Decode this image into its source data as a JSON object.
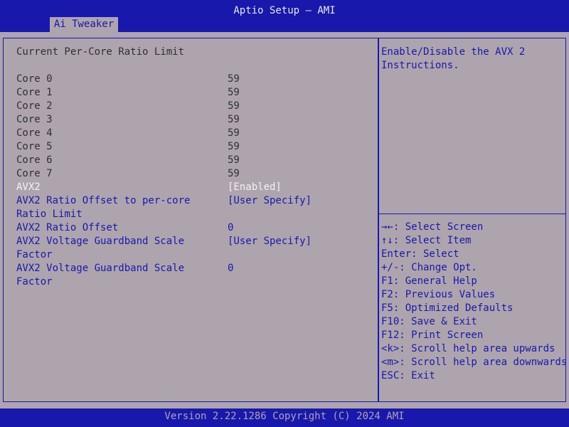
{
  "app_title": "Aptio Setup – AMI",
  "tab": "Ai Tweaker",
  "section_title": "Current Per-Core Ratio Limit",
  "cores": [
    {
      "label": "Core 0",
      "value": "59"
    },
    {
      "label": "Core 1",
      "value": "59"
    },
    {
      "label": "Core 2",
      "value": "59"
    },
    {
      "label": "Core 3",
      "value": "59"
    },
    {
      "label": "Core 4",
      "value": "59"
    },
    {
      "label": "Core 5",
      "value": "59"
    },
    {
      "label": "Core 6",
      "value": "59"
    },
    {
      "label": "Core 7",
      "value": "59"
    }
  ],
  "settings": {
    "avx2": {
      "label": "AVX2",
      "value": "[Enabled]"
    },
    "avx2_ratio_offset_mode": {
      "label_line1": "AVX2 Ratio Offset to per-core",
      "label_line2": "Ratio Limit",
      "value": "[User Specify]"
    },
    "avx2_ratio_offset": {
      "label": "AVX2 Ratio Offset",
      "value": "0"
    },
    "avx2_guardband_mode": {
      "label_line1": "AVX2 Voltage Guardband Scale",
      "label_line2": "Factor",
      "value": "[User Specify]"
    },
    "avx2_guardband_value": {
      "label_line1": "AVX2 Voltage Guardband Scale",
      "label_line2": "Factor",
      "value": "0"
    }
  },
  "help": "Enable/Disable the AVX 2\nInstructions.",
  "key_help": [
    "→←: Select Screen",
    "↑↓: Select Item",
    "Enter: Select",
    "+/-: Change Opt.",
    "F1: General Help",
    "F2: Previous Values",
    "F5: Optimized Defaults",
    "F10: Save & Exit",
    "F12: Print Screen",
    "<k>: Scroll help area upwards",
    "<m>: Scroll help area downwards",
    "ESC: Exit"
  ],
  "footer": "Version 2.22.1286 Copyright (C) 2024 AMI",
  "colors": {
    "accent": "#1818ac",
    "background": "#aea4ae",
    "selected_text": "#f2f2f2"
  }
}
